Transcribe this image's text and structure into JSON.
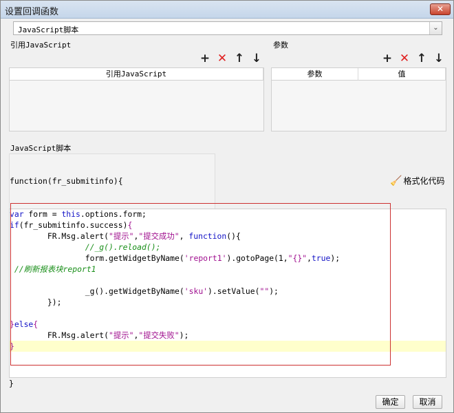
{
  "window": {
    "title": "设置回调函数",
    "close_label": "✕"
  },
  "script_type": {
    "value": "JavaScript脚本",
    "arrow": "⌄"
  },
  "left_section": {
    "label": "引用JavaScript",
    "toolbar": {
      "add": "+",
      "delete": "✕",
      "up": "↑",
      "down": "↓"
    },
    "column_header": "引用JavaScript"
  },
  "right_section": {
    "label": "参数",
    "toolbar": {
      "add": "+",
      "delete": "✕",
      "up": "↑",
      "down": "↓"
    },
    "columns": [
      "参数",
      "值"
    ]
  },
  "script_section": {
    "label": "JavaScript脚本",
    "function_header": "function(fr_submitinfo){",
    "format_label": "格式化代码",
    "closing_brace": "}"
  },
  "code": [
    {
      "parts": [
        {
          "c": "kw",
          "t": "var"
        },
        {
          "c": "blk",
          "t": " form = "
        },
        {
          "c": "kw",
          "t": "this"
        },
        {
          "c": "blk",
          "t": ".options.form;"
        }
      ]
    },
    {
      "parts": [
        {
          "c": "kw",
          "t": "if"
        },
        {
          "c": "blk",
          "t": "(fr_submitinfo.success)"
        },
        {
          "c": "str",
          "t": "{"
        }
      ]
    },
    {
      "parts": [
        {
          "c": "blk",
          "t": "        FR.Msg.alert("
        },
        {
          "c": "str",
          "t": "\"提示\""
        },
        {
          "c": "blk",
          "t": ","
        },
        {
          "c": "str",
          "t": "\"提交成功\""
        },
        {
          "c": "blk",
          "t": ", "
        },
        {
          "c": "kw",
          "t": "function"
        },
        {
          "c": "blk",
          "t": "(){"
        }
      ]
    },
    {
      "parts": [
        {
          "c": "cmt",
          "t": "                //_g().reload();"
        }
      ]
    },
    {
      "parts": [
        {
          "c": "blk",
          "t": "                form.getWidgetByName("
        },
        {
          "c": "str",
          "t": "'report1'"
        },
        {
          "c": "blk",
          "t": ").gotoPage(1,"
        },
        {
          "c": "str",
          "t": "\"{}\""
        },
        {
          "c": "blk",
          "t": ","
        },
        {
          "c": "kw",
          "t": "true"
        },
        {
          "c": "blk",
          "t": ");"
        }
      ]
    },
    {
      "parts": [
        {
          "c": "cmt",
          "t": " //刷新报表块report1"
        }
      ]
    },
    {
      "parts": [
        {
          "c": "blk",
          "t": ""
        }
      ]
    },
    {
      "parts": [
        {
          "c": "blk",
          "t": "                _g().getWidgetByName("
        },
        {
          "c": "str",
          "t": "'sku'"
        },
        {
          "c": "blk",
          "t": ").setValue("
        },
        {
          "c": "str",
          "t": "\"\""
        },
        {
          "c": "blk",
          "t": ");"
        }
      ]
    },
    {
      "parts": [
        {
          "c": "blk",
          "t": "        });"
        }
      ]
    },
    {
      "parts": [
        {
          "c": "blk",
          "t": ""
        }
      ]
    },
    {
      "parts": [
        {
          "c": "str",
          "t": "}"
        },
        {
          "c": "kw",
          "t": "else"
        },
        {
          "c": "str",
          "t": "{"
        }
      ]
    },
    {
      "parts": [
        {
          "c": "blk",
          "t": "        FR.Msg.alert("
        },
        {
          "c": "str",
          "t": "\"提示\""
        },
        {
          "c": "blk",
          "t": ","
        },
        {
          "c": "str",
          "t": "\"提交失败\""
        },
        {
          "c": "blk",
          "t": ");"
        }
      ]
    },
    {
      "parts": [
        {
          "c": "str",
          "t": "}"
        }
      ]
    }
  ],
  "buttons": {
    "ok": "确定",
    "cancel": "取消"
  }
}
